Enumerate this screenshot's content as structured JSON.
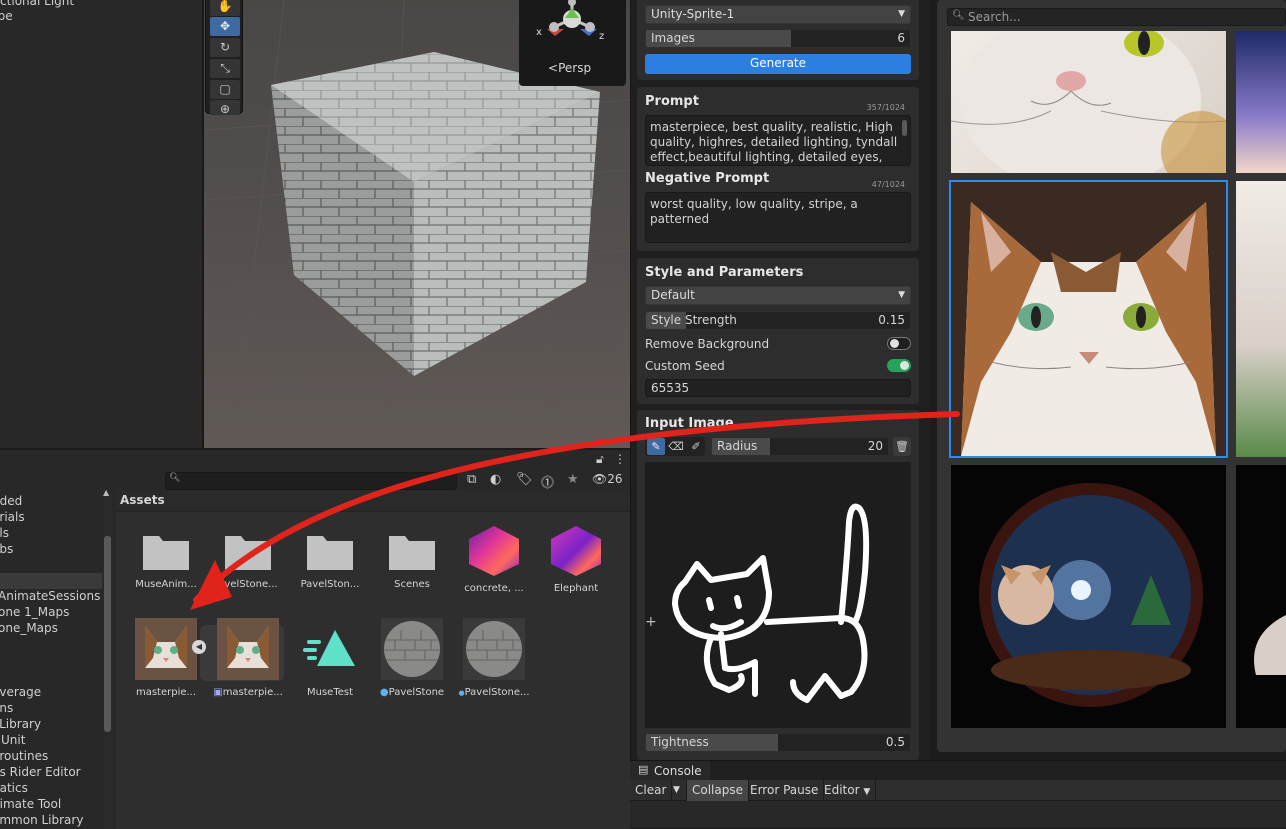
{
  "hierarchy": {
    "items": [
      "rectional Light",
      "ube"
    ]
  },
  "scene": {
    "gizmo_x": "x",
    "gizmo_z": "z",
    "persp_label": "Persp"
  },
  "project": {
    "toolbar_count": "26",
    "assets_title": "Assets",
    "folders": [
      "uded",
      "erials",
      "els",
      "abs",
      "",
      "AnimateSessions",
      "one 1_Maps",
      "one_Maps",
      "",
      "overage",
      "ons",
      "' Library",
      " NUnit",
      "oroutines",
      "ns Rider Editor",
      "natics",
      "nimate Tool",
      "ommon Library"
    ],
    "assets": [
      {
        "name": "MuseAnim..."
      },
      {
        "name": "avelStone..."
      },
      {
        "name": "PavelSton..."
      },
      {
        "name": "Scenes"
      },
      {
        "name": "concrete, ..."
      },
      {
        "name": "Elephant"
      },
      {
        "name": "masterpie..."
      },
      {
        "name": "masterpie..."
      },
      {
        "name": "MuseTest"
      },
      {
        "name": "PavelStone"
      },
      {
        "name": "PavelStone..."
      }
    ]
  },
  "muse": {
    "model_dropdown": "Unity-Sprite-1",
    "images_label": "Images",
    "images_value": "6",
    "images_fraction": 0.55,
    "generate_button": "Generate",
    "prompt_title": "Prompt",
    "prompt_counter": "357/1024",
    "prompt_text": "masterpiece, best quality, realistic, High quality, highres, detailed lighting, tyndall effect,beautiful lighting, detailed eyes,",
    "negative_title": "Negative Prompt",
    "negative_counter": "47/1024",
    "negative_text": "worst quality, low quality, stripe, a patterned",
    "style_title": "Style and Parameters",
    "style_dropdown": "Default",
    "style_strength_label": "Style Strength",
    "style_strength_value": "0.15",
    "style_strength_fraction": 0.15,
    "remove_bg_label": "Remove Background",
    "remove_bg_on": false,
    "custom_seed_label": "Custom Seed",
    "custom_seed_on": true,
    "seed_value": "65535",
    "input_title": "Input Image",
    "radius_label": "Radius",
    "radius_value": "20",
    "radius_fraction": 0.33,
    "tightness_label": "Tightness",
    "tightness_value": "0.5",
    "tightness_fraction": 0.5
  },
  "grid": {
    "search_placeholder": "Search..."
  },
  "console": {
    "tab": "Console",
    "clear": "Clear",
    "collapse": "Collapse",
    "error_pause": "Error Pause",
    "editor": "Editor"
  },
  "colors": {
    "accent": "#2c7ee0",
    "toggle_on": "#26a35a",
    "arrow": "#e0241c"
  }
}
